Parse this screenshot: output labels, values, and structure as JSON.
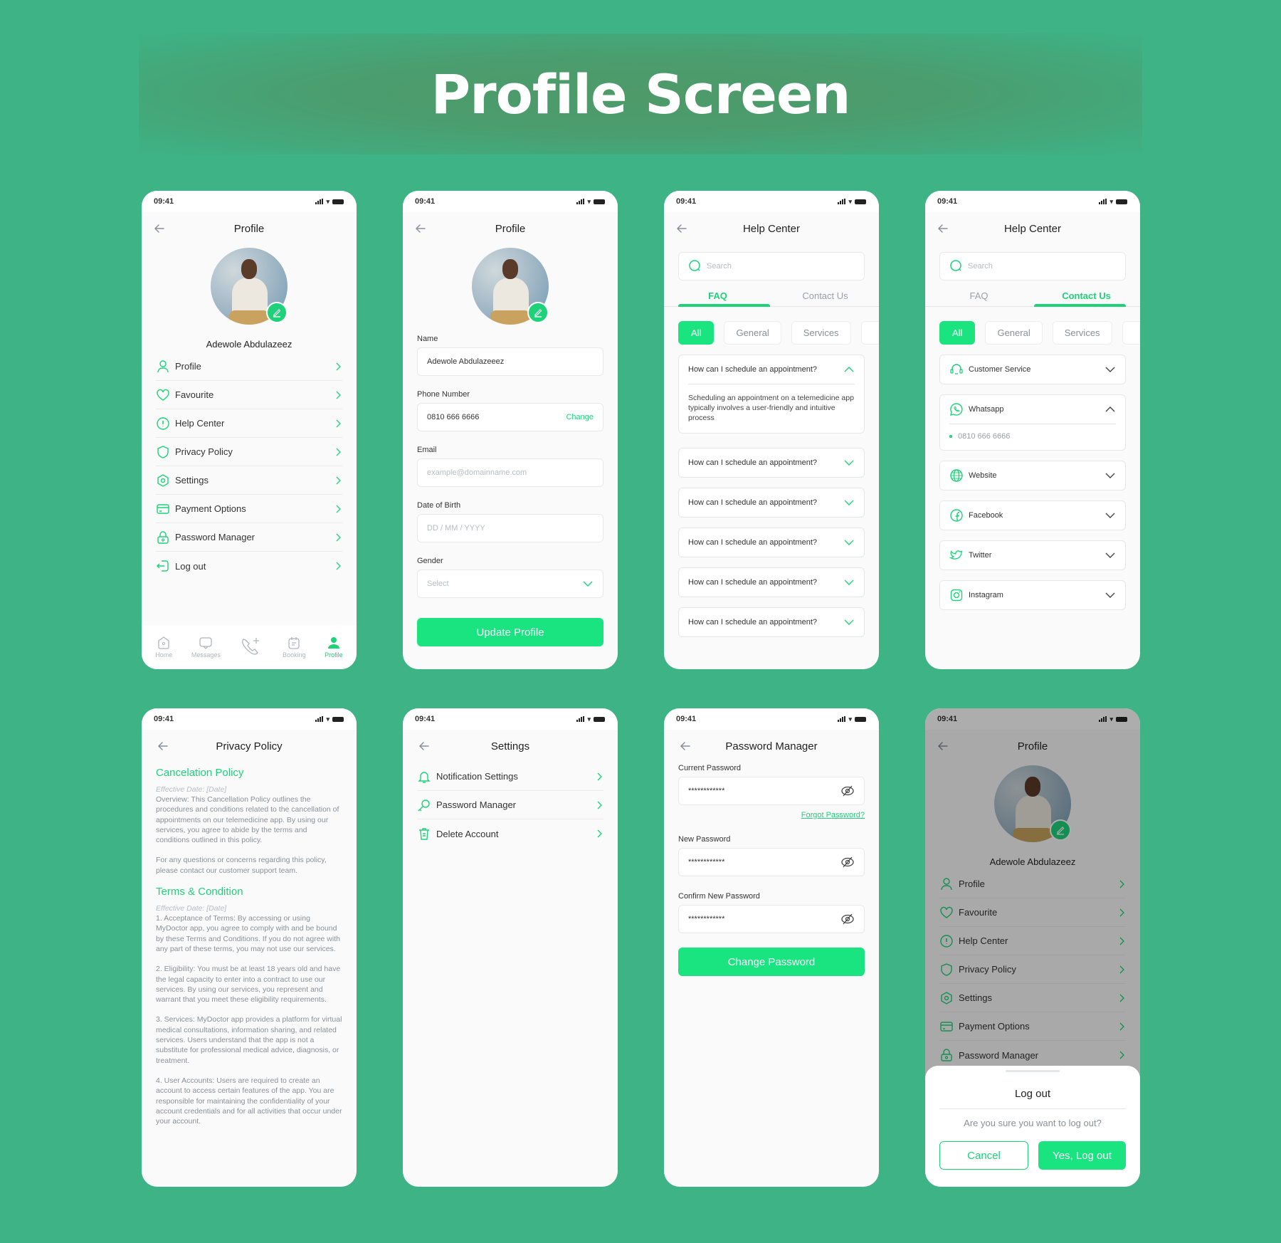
{
  "banner": {
    "title": "Profile Screen"
  },
  "colors": {
    "background": "#3db386",
    "accent": "#19e47f",
    "accent_text": "#1ed27a"
  },
  "status_bar": {
    "time": "09:41"
  },
  "user": {
    "name": "Adewole Abdulazeez"
  },
  "profile_menu": {
    "title": "Profile",
    "items": [
      {
        "label": "Profile",
        "icon": "user-icon"
      },
      {
        "label": "Favourite",
        "icon": "heart-icon"
      },
      {
        "label": "Help Center",
        "icon": "info-icon"
      },
      {
        "label": "Privacy Policy",
        "icon": "shield-icon"
      },
      {
        "label": "Settings",
        "icon": "gear-icon"
      },
      {
        "label": "Payment Options",
        "icon": "card-icon"
      },
      {
        "label": "Password Manager",
        "icon": "lock-icon"
      },
      {
        "label": "Log out",
        "icon": "logout-icon"
      }
    ],
    "tabbar": [
      {
        "label": "Home",
        "icon": "home-icon",
        "active": false
      },
      {
        "label": "Messages",
        "icon": "message-icon",
        "active": false
      },
      {
        "label": "",
        "icon": "call-add-icon",
        "active": false
      },
      {
        "label": "Booking",
        "icon": "calendar-icon",
        "active": false
      },
      {
        "label": "Profile",
        "icon": "user-filled-icon",
        "active": true
      }
    ]
  },
  "edit_profile": {
    "title": "Profile",
    "name_label": "Name",
    "name_value": "Adewole Abdulazeeez",
    "phone_label": "Phone Number",
    "phone_value": "0810 666 6666",
    "phone_action": "Change",
    "email_label": "Email",
    "email_placeholder": "example@domainname.com",
    "dob_label": "Date of Birth",
    "dob_placeholder": "DD / MM / YYYY",
    "gender_label": "Gender",
    "gender_placeholder": "Select",
    "submit": "Update Profile"
  },
  "help_center": {
    "title": "Help Center",
    "search_placeholder": "Search",
    "tabs": [
      "FAQ",
      "Contact Us"
    ],
    "chips": [
      "All",
      "General",
      "Services"
    ],
    "faq": [
      {
        "question": "How can I schedule an appointment?",
        "answer": "Scheduling an appointment on a telemedicine app typically involves a user-friendly and intuitive process",
        "expanded": true
      },
      {
        "question": "How can I schedule an appointment?",
        "expanded": false
      },
      {
        "question": "How can I schedule an appointment?",
        "expanded": false
      },
      {
        "question": "How can I schedule an appointment?",
        "expanded": false
      },
      {
        "question": "How can I schedule an appointment?",
        "expanded": false
      },
      {
        "question": "How can I schedule an appointment?",
        "expanded": false
      }
    ],
    "contacts": [
      {
        "label": "Customer Service",
        "icon": "headset-icon",
        "expanded": false
      },
      {
        "label": "Whatsapp",
        "icon": "whatsapp-icon",
        "expanded": true,
        "detail": "0810 666 6666"
      },
      {
        "label": "Website",
        "icon": "globe-icon",
        "expanded": false
      },
      {
        "label": "Facebook",
        "icon": "facebook-icon",
        "expanded": false
      },
      {
        "label": "Twitter",
        "icon": "twitter-icon",
        "expanded": false
      },
      {
        "label": "Instagram",
        "icon": "instagram-icon",
        "expanded": false
      }
    ]
  },
  "privacy": {
    "title": "Privacy Policy",
    "sections": [
      {
        "heading": "Cancelation Policy",
        "effective": "Effective Date: [Date]",
        "paragraphs": [
          "Overview: This Cancellation Policy outlines the procedures and conditions related to the cancellation of appointments on our telemedicine app. By using our services, you agree to abide by the terms and conditions outlined in this policy.",
          "For any questions or concerns regarding this policy, please contact our customer support team."
        ]
      },
      {
        "heading": "Terms & Condition",
        "effective": "Effective Date: [Date]",
        "paragraphs": [
          "1. Acceptance of Terms: By accessing or using MyDoctor app, you agree to comply with and be bound by these Terms and Conditions. If you do not agree with any part of these terms, you may not use our services.",
          "2. Eligibility: You must be at least 18 years old and have the legal capacity to enter into a contract to use our services. By using our services, you represent and warrant that you meet these eligibility requirements.",
          "3. Services: MyDoctor app provides a platform for virtual medical consultations, information sharing, and related services. Users understand that the app is not a substitute for professional medical advice, diagnosis, or treatment.",
          "4. User Accounts: Users are required to create an account to access certain features of the app. You are responsible for maintaining the confidentiality of your account credentials and for all activities that occur under your account."
        ]
      }
    ]
  },
  "settings": {
    "title": "Settings",
    "items": [
      {
        "label": "Notification Settings",
        "icon": "bell-icon"
      },
      {
        "label": "Password Manager",
        "icon": "key-icon"
      },
      {
        "label": "Delete Account",
        "icon": "trash-icon"
      }
    ]
  },
  "password_manager": {
    "title": "Password Manager",
    "current_label": "Current Password",
    "current_value": "************",
    "forgot": "Forgot Password?",
    "new_label": "New Password",
    "new_value": "************",
    "confirm_label": "Confirm New Password",
    "confirm_value": "************",
    "submit": "Change Password"
  },
  "logout_sheet": {
    "title": "Log out",
    "message": "Are you sure you want to log out?",
    "cancel": "Cancel",
    "confirm": "Yes, Log out"
  }
}
